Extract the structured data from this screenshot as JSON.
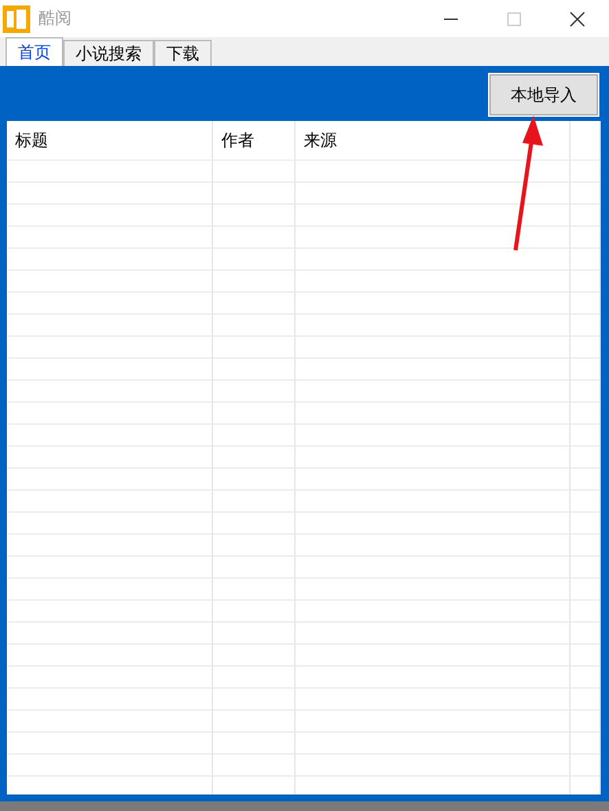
{
  "window": {
    "title": "酷阅"
  },
  "tabs": [
    {
      "label": "首页",
      "selected": true
    },
    {
      "label": "小说搜索",
      "selected": false
    },
    {
      "label": "下载",
      "selected": false
    }
  ],
  "import_button": "本地导入",
  "table": {
    "columns": [
      "标题",
      "作者",
      "来源"
    ]
  }
}
